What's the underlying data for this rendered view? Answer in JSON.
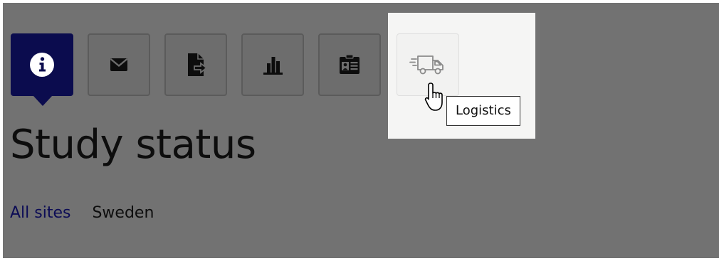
{
  "toolbar": {
    "buttons": [
      {
        "id": "info",
        "icon": "info-circle-icon",
        "active": true
      },
      {
        "id": "messages",
        "icon": "envelope-icon",
        "active": false
      },
      {
        "id": "export",
        "icon": "file-export-icon",
        "active": false
      },
      {
        "id": "statistics",
        "icon": "bar-chart-icon",
        "active": false
      },
      {
        "id": "id-card",
        "icon": "id-card-clipboard-icon",
        "active": false
      },
      {
        "id": "logistics",
        "icon": "delivery-truck-icon",
        "active": false,
        "highlighted": true
      }
    ],
    "tooltip": "Logistics"
  },
  "page": {
    "title": "Study status"
  },
  "breadcrumb": {
    "link": "All sites",
    "current": "Sweden"
  },
  "colors": {
    "overlay": "#727272",
    "active_button": "#0b0c4e",
    "link": "#0c0c55",
    "spotlight": "#f5f5f4"
  }
}
